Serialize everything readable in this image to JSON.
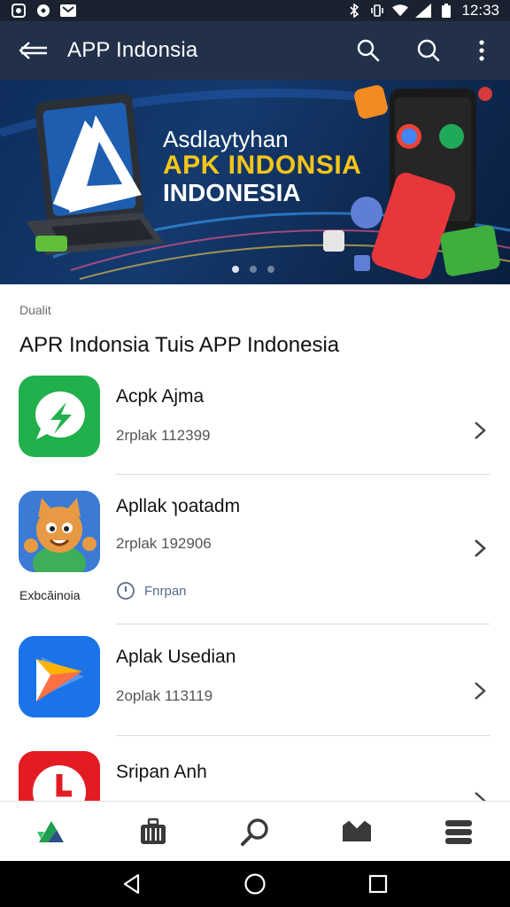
{
  "status_bar": {
    "time": "12:33"
  },
  "app_bar": {
    "title": "APP Indonsia"
  },
  "banner": {
    "line1": "Asdlaytyhan",
    "line2": "APK INDONSIA",
    "line3": "INDONESIA"
  },
  "section": {
    "label": "Dualit",
    "title": "APR Indonsia Tuis APP Indonesia"
  },
  "items": [
    {
      "name": "Acpk Ajma",
      "sub": "2rplak 112399"
    },
    {
      "name": "Apllak ɿoatadm",
      "sub": "2rplak 192906",
      "under_label": "Exbcăinoia",
      "meta": "Fnrpan"
    },
    {
      "name": "Aplak Usedian",
      "sub": "2oplak 113119"
    },
    {
      "name": "Sripan Anh"
    }
  ],
  "colors": {
    "status_bar": "#1a2230",
    "app_bar": "#223049",
    "accent_yellow": "#f5c518",
    "icon_green": "#21b04b",
    "icon_blue": "#1a73e8",
    "icon_red": "#e31c23"
  }
}
